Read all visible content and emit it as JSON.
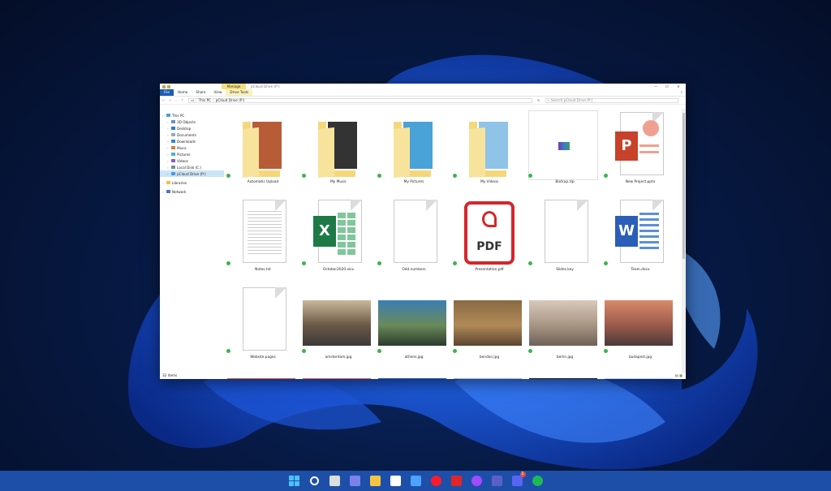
{
  "window": {
    "title": "pCloud Drive (P:)",
    "manage_tab": "Manage",
    "controls": [
      "—",
      "☐",
      "✕"
    ]
  },
  "ribbon": {
    "tabs": [
      "File",
      "Home",
      "Share",
      "View",
      "Drive Tools"
    ]
  },
  "address": {
    "segments": [
      "This PC",
      "pCloud Drive (P:)"
    ],
    "search_placeholder": "Search pCloud Drive (P:)"
  },
  "nav": {
    "items": [
      {
        "label": "This PC",
        "level": 0
      },
      {
        "label": "3D Objects",
        "level": 1
      },
      {
        "label": "Desktop",
        "level": 1
      },
      {
        "label": "Documents",
        "level": 1
      },
      {
        "label": "Downloads",
        "level": 1
      },
      {
        "label": "Music",
        "level": 1
      },
      {
        "label": "Pictures",
        "level": 1
      },
      {
        "label": "Videos",
        "level": 1
      },
      {
        "label": "Local Disk (C:)",
        "level": 1
      },
      {
        "label": "pCloud Drive (P:)",
        "level": 1,
        "selected": true
      },
      {
        "label": "Libraries",
        "level": 0
      },
      {
        "label": "Network",
        "level": 0
      }
    ]
  },
  "files": [
    {
      "name": "Automatic Upload",
      "kind": "folder",
      "accent": "#b85c38"
    },
    {
      "name": "My Music",
      "kind": "folder",
      "accent": "#333333"
    },
    {
      "name": "My Pictures",
      "kind": "folder",
      "accent": "#4aa3d8"
    },
    {
      "name": "My Videos",
      "kind": "folder",
      "accent": "#8fc3e8"
    },
    {
      "name": "Backup.zip",
      "kind": "zip"
    },
    {
      "name": "New Project.pptx",
      "kind": "pptx"
    },
    {
      "name": "Notes.txt",
      "kind": "txt"
    },
    {
      "name": "October2020.xlsx",
      "kind": "xlsx"
    },
    {
      "name": "Odd.numbers",
      "kind": "blank"
    },
    {
      "name": "Presentation.pdf",
      "kind": "pdf"
    },
    {
      "name": "Slides.key",
      "kind": "blank"
    },
    {
      "name": "Team.docx",
      "kind": "docx"
    },
    {
      "name": "Website.pages",
      "kind": "blank"
    },
    {
      "name": "amsterdam.jpg",
      "kind": "photo",
      "colors": [
        "#c9b89a",
        "#6b5846",
        "#3c3a39"
      ]
    },
    {
      "name": "athens.jpg",
      "kind": "photo",
      "colors": [
        "#3a7fb3",
        "#6a8a5a",
        "#2b3b2c"
      ]
    },
    {
      "name": "bendon.jpg",
      "kind": "photo",
      "colors": [
        "#8a6a43",
        "#b08a57",
        "#5c4430"
      ]
    },
    {
      "name": "berlin.jpg",
      "kind": "photo",
      "colors": [
        "#d8c9bb",
        "#a89584",
        "#6e6158"
      ]
    },
    {
      "name": "budapest.jpg",
      "kind": "photo",
      "colors": [
        "#d88a6a",
        "#9a5a4a",
        "#4a3a3a"
      ]
    },
    {
      "name": "",
      "kind": "photo",
      "colors": [
        "#d9613a",
        "#9c2f2c",
        "#2a1a2a"
      ]
    },
    {
      "name": "",
      "kind": "photo",
      "colors": [
        "#e06b4a",
        "#5a4a7a",
        "#1e2a4a"
      ]
    },
    {
      "name": "",
      "kind": "photo",
      "colors": [
        "#2a5a9a",
        "#5a7ab0",
        "#c8d6e8"
      ]
    },
    {
      "name": "",
      "kind": "photo",
      "colors": [
        "#a8b8c8",
        "#6a7a8a",
        "#3a4a5a"
      ]
    },
    {
      "name": "",
      "kind": "photo",
      "colors": [
        "#1a1a1a",
        "#7a6a5a",
        "#d8c8a8"
      ]
    },
    {
      "name": "",
      "kind": "photo",
      "colors": [
        "#c8d8e8",
        "#8aa8c8",
        "#4a6a8a"
      ]
    }
  ],
  "status": {
    "count": "32 items"
  },
  "taskbar": {
    "icons": [
      {
        "name": "windows-start-icon",
        "color": "#4cc2ff"
      },
      {
        "name": "search-icon",
        "color": "#ffffff"
      },
      {
        "name": "task-view-icon",
        "color": "#dddddd"
      },
      {
        "name": "teams-chat-icon",
        "color": "#7b83eb"
      },
      {
        "name": "file-explorer-icon",
        "color": "#f5c542"
      },
      {
        "name": "microsoft-store-icon",
        "color": "#ffffff"
      },
      {
        "name": "mail-icon",
        "color": "#4aa3ff"
      },
      {
        "name": "opera-icon",
        "color": "#ff1b2d"
      },
      {
        "name": "wps-office-icon",
        "color": "#e0252b"
      },
      {
        "name": "messenger-icon",
        "color": "#a04bff"
      },
      {
        "name": "teams-icon",
        "color": "#5b5fc7"
      },
      {
        "name": "discord-icon",
        "color": "#5865f2",
        "badge": "1"
      },
      {
        "name": "spotify-icon",
        "color": "#1db954"
      }
    ]
  }
}
